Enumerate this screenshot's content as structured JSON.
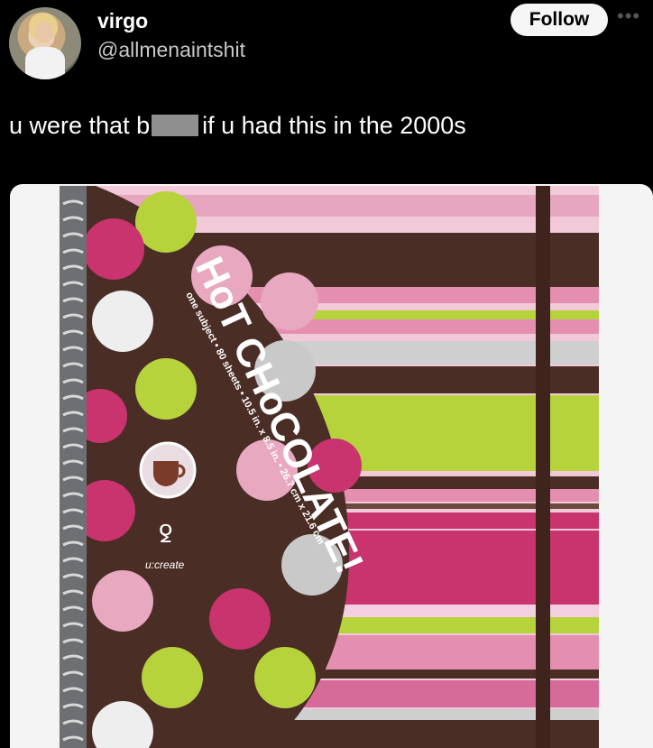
{
  "user": {
    "display_name": "virgo",
    "handle": "@allmenaintshit",
    "follow_label": "Follow"
  },
  "more_icon": "more-horizontal-icon",
  "tweet": {
    "text_before": "u were that b",
    "text_after": "if u had this in the 2000s"
  },
  "notebook": {
    "title": "HoT CHoCOLATE!",
    "subtitle": "one subject • 80 sheets • 10.5 in. x 8.5 in. • 26.7 cm x 21.6 cm",
    "brand": "u:create",
    "colors": {
      "brown": "#4a2d25",
      "pink": "#e8a8c0",
      "magenta": "#c9336e",
      "lime": "#b6d33c",
      "light_pink": "#f4cfe0"
    }
  }
}
